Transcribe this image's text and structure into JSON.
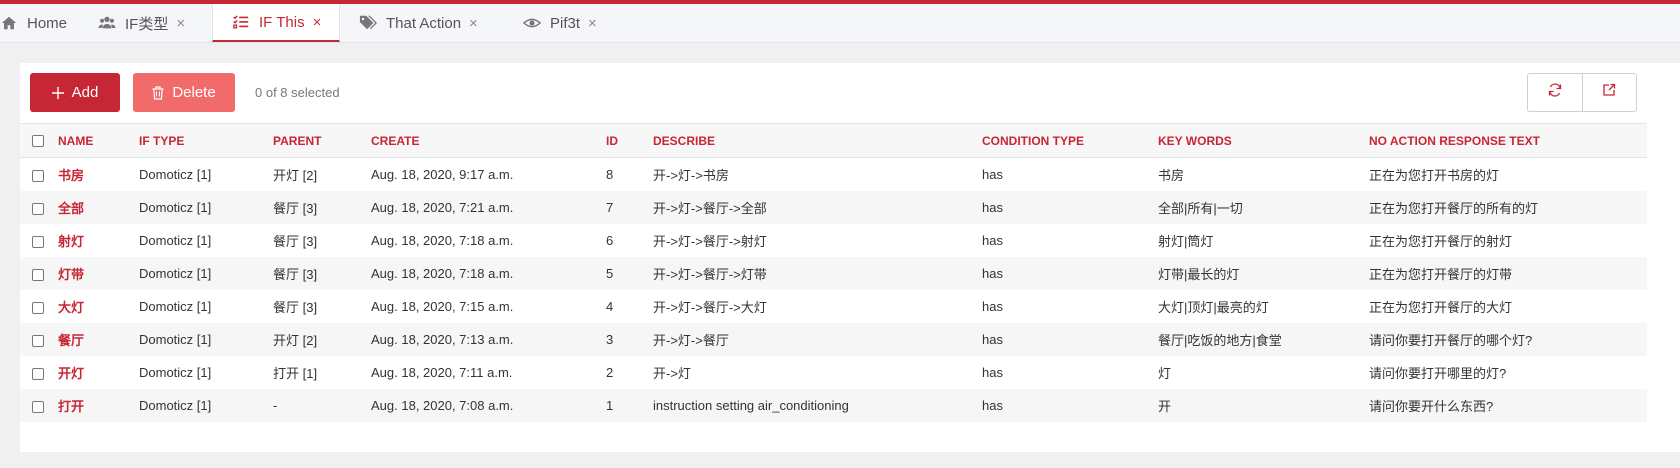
{
  "tabs": [
    {
      "label": "Home",
      "icon": "home-icon",
      "closable": false,
      "active": false
    },
    {
      "label": "IF类型",
      "icon": "users-icon",
      "closable": true,
      "active": false
    },
    {
      "label": "IF This",
      "icon": "list-check-icon",
      "closable": true,
      "active": true
    },
    {
      "label": "That Action",
      "icon": "tags-icon",
      "closable": true,
      "active": false
    },
    {
      "label": "Pif3t",
      "icon": "eye-icon",
      "closable": true,
      "active": false
    }
  ],
  "tab_close_glyph": "×",
  "toolbar": {
    "add_label": "Add",
    "delete_label": "Delete",
    "selected_text": "0 of 8 selected"
  },
  "table": {
    "headers": [
      "NAME",
      "IF TYPE",
      "PARENT",
      "CREATE",
      "ID",
      "DESCRIBE",
      "CONDITION TYPE",
      "KEY WORDS",
      "NO ACTION RESPONSE TEXT"
    ],
    "rows": [
      {
        "name": "书房",
        "if_type": "Domoticz [1]",
        "parent": "开灯 [2]",
        "create": "Aug. 18, 2020, 9:17 a.m.",
        "id": "8",
        "describe": "开->灯->书房",
        "condition_type": "has",
        "key_words": "书房",
        "response": "正在为您打开书房的灯"
      },
      {
        "name": "全部",
        "if_type": "Domoticz [1]",
        "parent": "餐厅 [3]",
        "create": "Aug. 18, 2020, 7:21 a.m.",
        "id": "7",
        "describe": "开->灯->餐厅->全部",
        "condition_type": "has",
        "key_words": "全部|所有|一切",
        "response": "正在为您打开餐厅的所有的灯"
      },
      {
        "name": "射灯",
        "if_type": "Domoticz [1]",
        "parent": "餐厅 [3]",
        "create": "Aug. 18, 2020, 7:18 a.m.",
        "id": "6",
        "describe": "开->灯->餐厅->射灯",
        "condition_type": "has",
        "key_words": "射灯|筒灯",
        "response": "正在为您打开餐厅的射灯"
      },
      {
        "name": "灯带",
        "if_type": "Domoticz [1]",
        "parent": "餐厅 [3]",
        "create": "Aug. 18, 2020, 7:18 a.m.",
        "id": "5",
        "describe": "开->灯->餐厅->灯带",
        "condition_type": "has",
        "key_words": "灯带|最长的灯",
        "response": "正在为您打开餐厅的灯带"
      },
      {
        "name": "大灯",
        "if_type": "Domoticz [1]",
        "parent": "餐厅 [3]",
        "create": "Aug. 18, 2020, 7:15 a.m.",
        "id": "4",
        "describe": "开->灯->餐厅->大灯",
        "condition_type": "has",
        "key_words": "大灯|顶灯|最亮的灯",
        "response": "正在为您打开餐厅的大灯"
      },
      {
        "name": "餐厅",
        "if_type": "Domoticz [1]",
        "parent": "开灯 [2]",
        "create": "Aug. 18, 2020, 7:13 a.m.",
        "id": "3",
        "describe": "开->灯->餐厅",
        "condition_type": "has",
        "key_words": "餐厅|吃饭的地方|食堂",
        "response": "请问你要打开餐厅的哪个灯?"
      },
      {
        "name": "开灯",
        "if_type": "Domoticz [1]",
        "parent": "打开 [1]",
        "create": "Aug. 18, 2020, 7:11 a.m.",
        "id": "2",
        "describe": "开->灯",
        "condition_type": "has",
        "key_words": "灯",
        "response": "请问你要打开哪里的灯?"
      },
      {
        "name": "打开",
        "if_type": "Domoticz [1]",
        "parent": "-",
        "create": "Aug. 18, 2020, 7:08 a.m.",
        "id": "1",
        "describe": "instruction setting air_conditioning",
        "condition_type": "has",
        "key_words": "开",
        "response": "请问你要开什么东西?"
      }
    ]
  },
  "colors": {
    "accent": "#c72735",
    "delete": "#f26b6b",
    "stripe": "#f6f6f6"
  }
}
